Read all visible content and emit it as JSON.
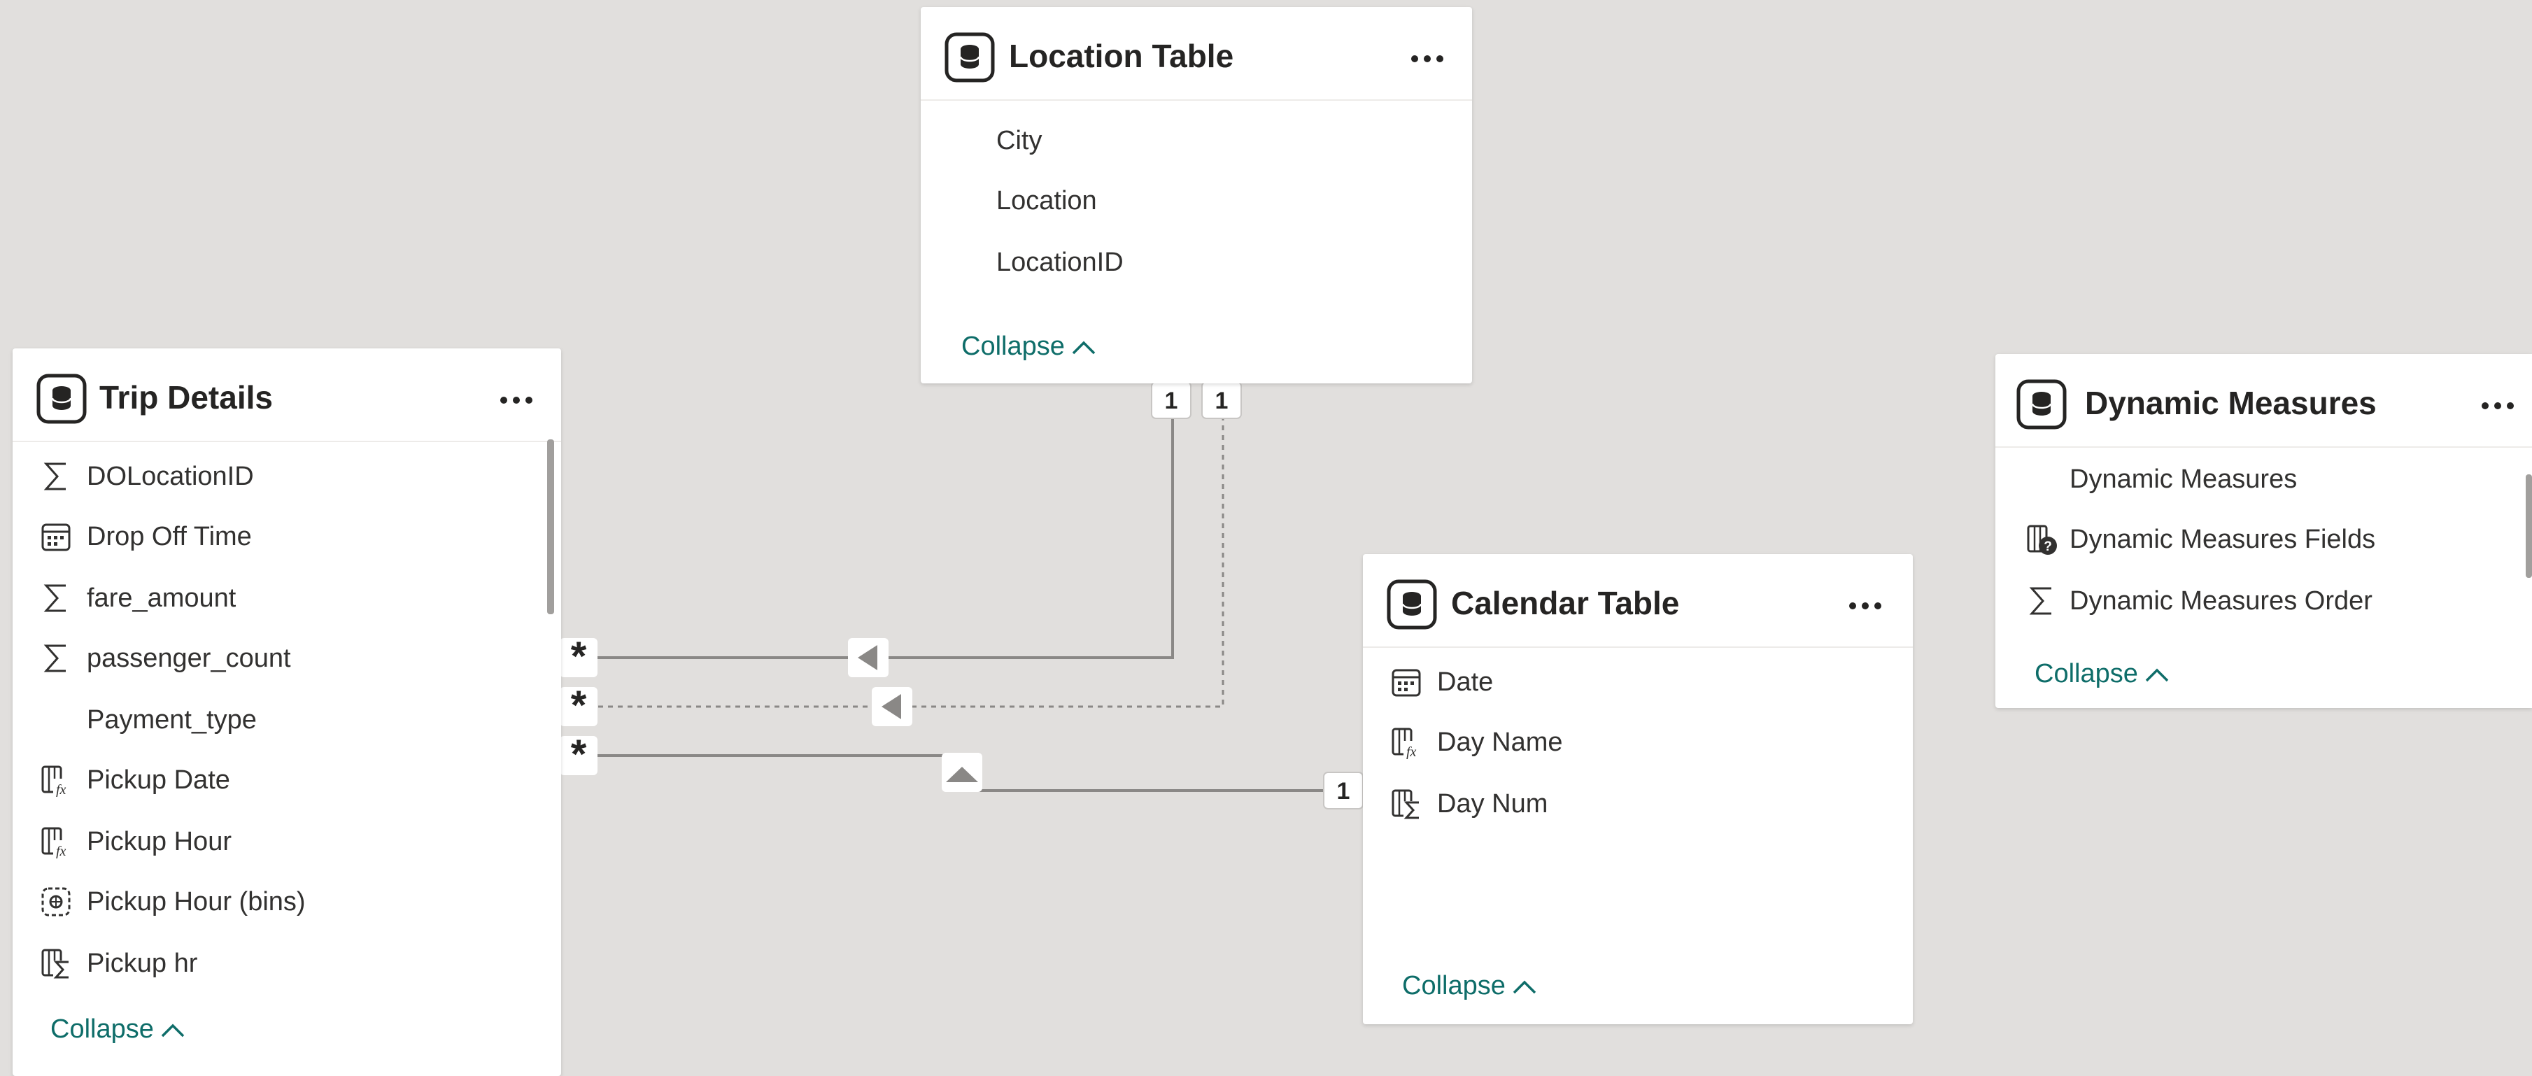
{
  "tables": {
    "location": {
      "title": "Location Table",
      "fields": [
        {
          "name": "City",
          "icon": "none"
        },
        {
          "name": "Location",
          "icon": "none"
        },
        {
          "name": "LocationID",
          "icon": "none"
        }
      ],
      "collapse_label": "Collapse"
    },
    "trip": {
      "title": "Trip Details",
      "fields": [
        {
          "name": "DOLocationID",
          "icon": "sigma-icon"
        },
        {
          "name": "Drop Off Time",
          "icon": "calendar-icon"
        },
        {
          "name": "fare_amount",
          "icon": "sigma-icon"
        },
        {
          "name": "passenger_count",
          "icon": "sigma-icon"
        },
        {
          "name": "Payment_type",
          "icon": "none"
        },
        {
          "name": "Pickup Date",
          "icon": "calculated-column-icon"
        },
        {
          "name": "Pickup Hour",
          "icon": "calculated-column-icon"
        },
        {
          "name": "Pickup Hour (bins)",
          "icon": "bins-icon"
        },
        {
          "name": "Pickup hr",
          "icon": "calculated-sum-icon"
        }
      ],
      "collapse_label": "Collapse"
    },
    "calendar": {
      "title": "Calendar Table",
      "fields": [
        {
          "name": "Date",
          "icon": "calendar-icon"
        },
        {
          "name": "Day Name",
          "icon": "calculated-column-icon"
        },
        {
          "name": "Day Num",
          "icon": "calculated-sum-icon"
        }
      ],
      "collapse_label": "Collapse"
    },
    "dynamic": {
      "title": "Dynamic Measures",
      "fields": [
        {
          "name": "Dynamic Measures",
          "icon": "none"
        },
        {
          "name": "Dynamic Measures Fields",
          "icon": "field-parameter-icon"
        },
        {
          "name": "Dynamic Measures Order",
          "icon": "sigma-icon"
        }
      ],
      "collapse_label": "Collapse"
    }
  },
  "relationships": {
    "one_label": "1",
    "many_label": "*"
  },
  "colors": {
    "canvas": "#e1dfdd",
    "accent": "#0e6d69",
    "line": "#8a8886"
  }
}
